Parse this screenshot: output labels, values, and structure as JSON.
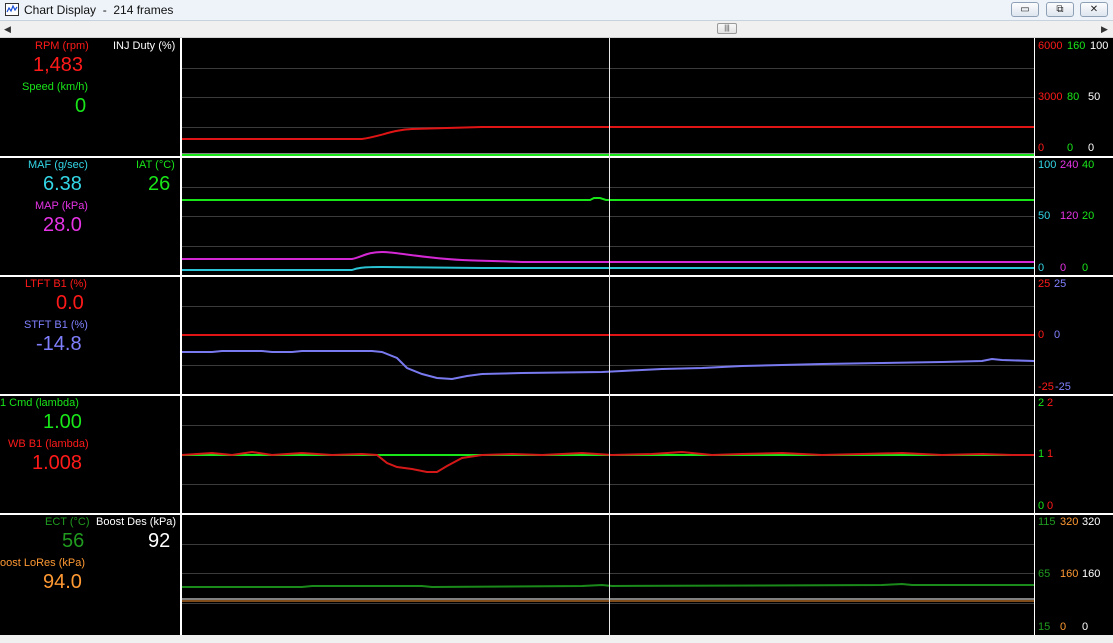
{
  "window": {
    "title": "Chart Display  -  214 frames",
    "minimize_glyph": "▭",
    "restore_glyph": "⧉",
    "close_glyph": "✕"
  },
  "scrollbar": {
    "thumb_glyph": "|||",
    "left_glyph": "◀",
    "right_glyph": "▶"
  },
  "colors": {
    "red": "#ff1a1a",
    "green": "#19e619",
    "white": "#ffffff",
    "cyan": "#33d6e6",
    "magenta": "#e633e6",
    "purple": "#8080ff",
    "dark_green": "#1f9a1f",
    "orange": "#ff9933",
    "background": "#000000"
  },
  "panels": [
    {
      "labels": [
        {
          "name": "RPM (rpm)",
          "value": "1,483",
          "color": "#ff1a1a"
        },
        {
          "name": "INJ Duty (%)",
          "value": "",
          "color": "#ffffff"
        },
        {
          "name": "Speed (km/h)",
          "value": "0",
          "color": "#19e619"
        }
      ],
      "axis": [
        {
          "top": [
            "6000",
            "160",
            "100"
          ],
          "mid": [
            "3000",
            "80",
            "50"
          ],
          "bottom": [
            "0",
            "0",
            "0"
          ]
        }
      ]
    },
    {
      "labels": [
        {
          "name": "MAF (g/sec)",
          "value": "6.38",
          "color": "#33d6e6"
        },
        {
          "name": "IAT (°C)",
          "value": "26",
          "color": "#19e619"
        },
        {
          "name": "MAP (kPa)",
          "value": "28.0",
          "color": "#e633e6"
        }
      ],
      "axis": [
        {
          "top": [
            "100",
            "240",
            "40"
          ],
          "mid": [
            "50",
            "120",
            "20"
          ],
          "bottom": [
            "0",
            "0",
            "0"
          ]
        }
      ]
    },
    {
      "labels": [
        {
          "name": "LTFT B1 (%)",
          "value": "0.0",
          "color": "#ff1a1a"
        },
        {
          "name": "STFT B1 (%)",
          "value": "-14.8",
          "color": "#8080ff"
        }
      ],
      "axis": [
        {
          "top": [
            "25",
            "25"
          ],
          "mid": [
            "0",
            "0"
          ],
          "bottom": [
            "-25",
            "-25"
          ]
        }
      ]
    },
    {
      "labels": [
        {
          "name": "1 Cmd  (lambda)",
          "value": "1.00",
          "color": "#19e619"
        },
        {
          "name": "WB B1 (lambda)",
          "value": "1.008",
          "color": "#ff1a1a"
        }
      ],
      "axis": [
        {
          "top": [
            "2",
            "2"
          ],
          "mid": [
            "1",
            "1"
          ],
          "bottom": [
            "0",
            "0"
          ]
        }
      ]
    },
    {
      "labels": [
        {
          "name": "ECT (°C)",
          "value": "56",
          "color": "#1f9a1f"
        },
        {
          "name": "Boost Des (kPa)",
          "value": "92",
          "color": "#ffffff"
        },
        {
          "name": "oost LoRes (kPa)",
          "value": "94.0",
          "color": "#ff9933"
        }
      ],
      "axis": [
        {
          "top": [
            "115",
            "320",
            "320"
          ],
          "mid": [
            "65",
            "160",
            "160"
          ],
          "bottom": [
            "15",
            "0",
            "0"
          ]
        }
      ]
    }
  ]
}
